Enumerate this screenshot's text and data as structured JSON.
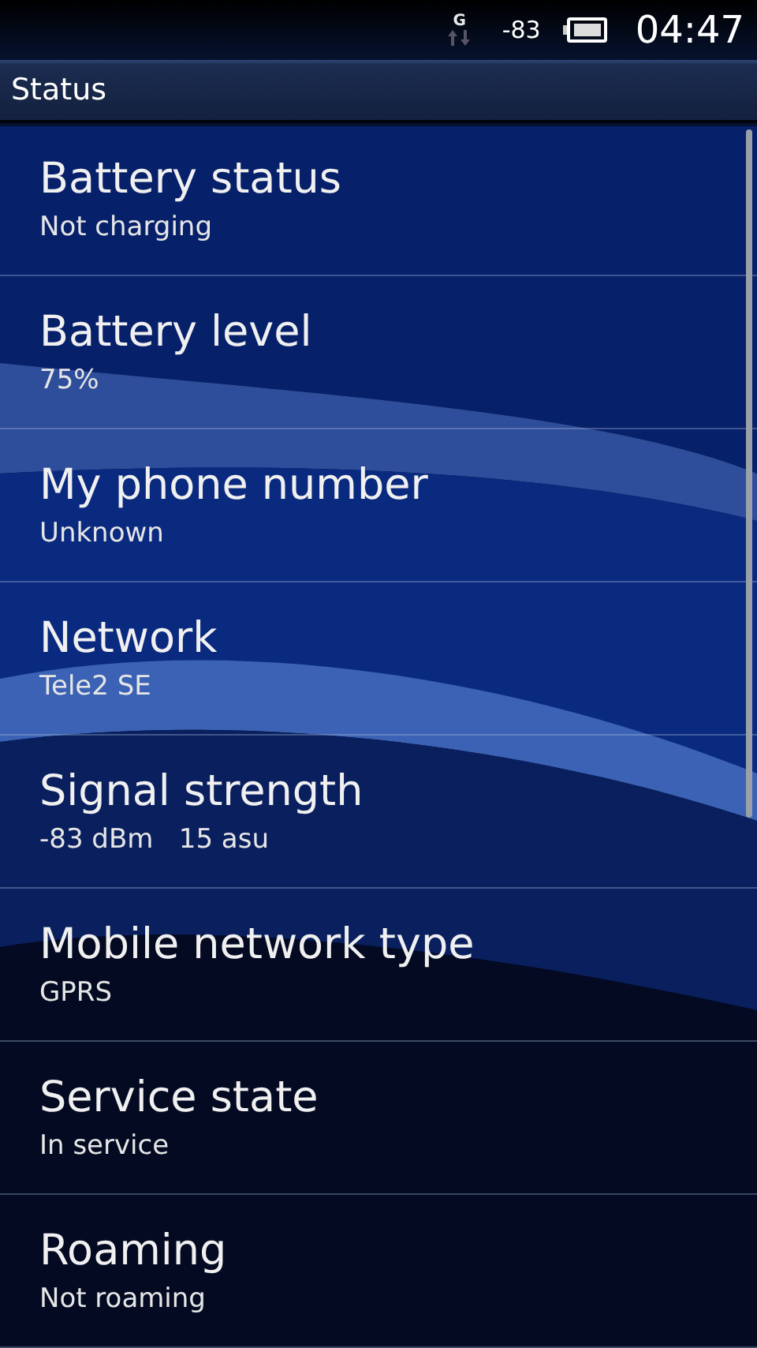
{
  "status_bar": {
    "network_type": "G",
    "signal": "-83",
    "time": "04:47"
  },
  "title_bar": {
    "title": "Status"
  },
  "items": [
    {
      "title": "Battery status",
      "value": "Not charging"
    },
    {
      "title": "Battery level",
      "value": "75%"
    },
    {
      "title": "My phone number",
      "value": "Unknown"
    },
    {
      "title": "Network",
      "value": "Tele2 SE"
    },
    {
      "title": "Signal strength",
      "value": "-83 dBm   15 asu"
    },
    {
      "title": "Mobile network type",
      "value": "GPRS"
    },
    {
      "title": "Service state",
      "value": "In service"
    },
    {
      "title": "Roaming",
      "value": "Not roaming"
    }
  ]
}
